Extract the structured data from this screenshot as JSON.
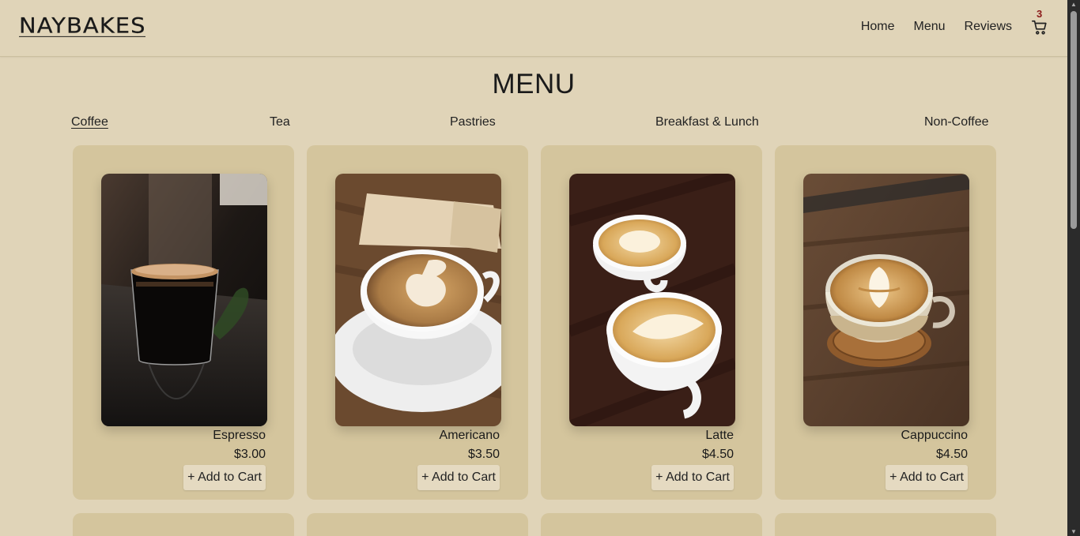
{
  "header": {
    "logo": "NAYBAKES",
    "nav": [
      "Home",
      "Menu",
      "Reviews"
    ],
    "cart_count": "3",
    "cart_icon": "cart-icon"
  },
  "page_title": "MENU",
  "categories": [
    "Coffee",
    "Tea",
    "Pastries",
    "Breakfast & Lunch",
    "Non-Coffee"
  ],
  "active_category": "Coffee",
  "products": [
    {
      "name": "Espresso",
      "price": "$3.00",
      "button": "+ Add to Cart"
    },
    {
      "name": "Americano",
      "price": "$3.50",
      "button": "+ Add to Cart"
    },
    {
      "name": "Latte",
      "price": "$4.50",
      "button": "+ Add to Cart"
    },
    {
      "name": "Cappuccino",
      "price": "$4.50",
      "button": "+ Add to Cart"
    }
  ],
  "colors": {
    "background": "#e0d4b8",
    "card": "#d4c59d",
    "cart_badge": "#8b1a1a"
  }
}
